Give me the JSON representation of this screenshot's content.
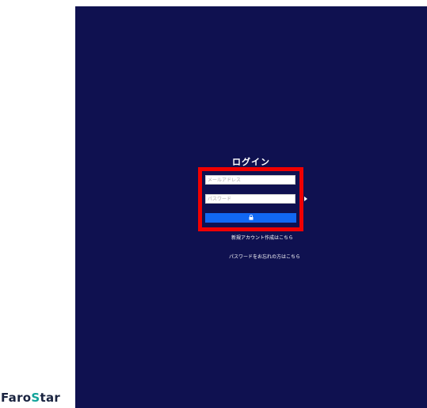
{
  "login": {
    "title": "ログイン",
    "email_placeholder": "メールアドレス",
    "password_placeholder": "パスワード",
    "submit_label": "🔒",
    "new_account_link": "新規アカウント作成はこちら",
    "forgot_password_link": "パスワードをお忘れの方はこちら"
  },
  "brand": {
    "logo_part1": "Faro",
    "logo_accent": "S",
    "logo_part2": "tar"
  },
  "colors": {
    "panel_bg": "#0f1150",
    "highlight": "#f00000",
    "button": "#1168f3",
    "logo_dark": "#1a2440",
    "logo_accent": "#10a39a"
  },
  "icons": [
    "lock-icon",
    "caret-right-icon"
  ]
}
